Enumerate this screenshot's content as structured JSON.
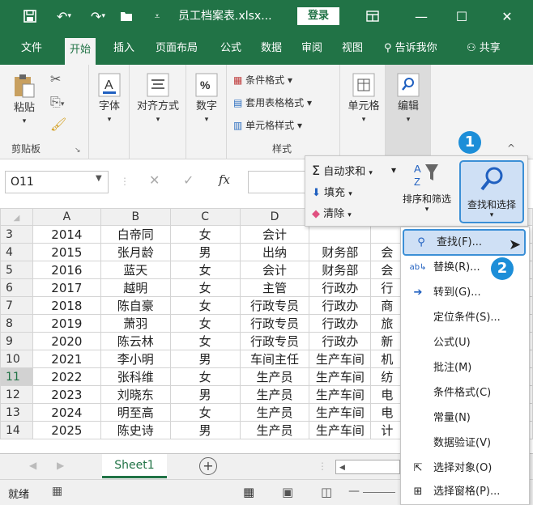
{
  "titlebar": {
    "title": "员工档案表.xlsx...",
    "login": "登录"
  },
  "menu_tabs": [
    "文件",
    "开始",
    "插入",
    "页面布局",
    "公式",
    "数据",
    "审阅",
    "视图"
  ],
  "tell_me": "告诉我你",
  "share": "共享",
  "ribbon": {
    "paste": "粘贴",
    "clipboard": "剪贴板",
    "font": "字体",
    "align": "对齐方式",
    "number": "数字",
    "cond_format": "条件格式",
    "table_format": "套用表格格式",
    "cell_style": "单元格样式",
    "styles": "样式",
    "cells": "单元格",
    "edit": "编辑"
  },
  "namebox": "O11",
  "fx": "fx",
  "columns": [
    "A",
    "B",
    "C",
    "D"
  ],
  "rows": [
    {
      "n": "3",
      "a": "2014",
      "b": "白帝同",
      "c": "女",
      "d": "会计",
      "e": "",
      "f": ""
    },
    {
      "n": "4",
      "a": "2015",
      "b": "张月龄",
      "c": "男",
      "d": "出纳",
      "e": "财务部",
      "f": "会"
    },
    {
      "n": "5",
      "a": "2016",
      "b": "蓝天",
      "c": "女",
      "d": "会计",
      "e": "财务部",
      "f": "会"
    },
    {
      "n": "6",
      "a": "2017",
      "b": "越明",
      "c": "女",
      "d": "主管",
      "e": "行政办",
      "f": "行"
    },
    {
      "n": "7",
      "a": "2018",
      "b": "陈自豪",
      "c": "女",
      "d": "行政专员",
      "e": "行政办",
      "f": "商"
    },
    {
      "n": "8",
      "a": "2019",
      "b": "萧羽",
      "c": "女",
      "d": "行政专员",
      "e": "行政办",
      "f": "旅"
    },
    {
      "n": "9",
      "a": "2020",
      "b": "陈云林",
      "c": "女",
      "d": "行政专员",
      "e": "行政办",
      "f": "新"
    },
    {
      "n": "10",
      "a": "2021",
      "b": "李小明",
      "c": "男",
      "d": "车间主任",
      "e": "生产车间",
      "f": "机"
    },
    {
      "n": "11",
      "a": "2022",
      "b": "张科维",
      "c": "女",
      "d": "生产员",
      "e": "生产车间",
      "f": "纺"
    },
    {
      "n": "12",
      "a": "2023",
      "b": "刘晓东",
      "c": "男",
      "d": "生产员",
      "e": "生产车间",
      "f": "电"
    },
    {
      "n": "13",
      "a": "2024",
      "b": "明至高",
      "c": "女",
      "d": "生产员",
      "e": "生产车间",
      "f": "电"
    },
    {
      "n": "14",
      "a": "2025",
      "b": "陈史诗",
      "c": "男",
      "d": "生产员",
      "e": "生产车间",
      "f": "计"
    }
  ],
  "sheet_tab": "Sheet1",
  "status": "就绪",
  "panel": {
    "autosum": "自动求和",
    "fill": "填充",
    "clear": "清除",
    "sort": "排序和筛选",
    "find": "查找和选择"
  },
  "menu_items": [
    "查找(F)...",
    "替换(R)...",
    "转到(G)...",
    "定位条件(S)...",
    "公式(U)",
    "批注(M)",
    "条件格式(C)",
    "常量(N)",
    "数据验证(V)",
    "选择对象(O)",
    "选择窗格(P)..."
  ],
  "badges": [
    "1",
    "2"
  ],
  "colors": {
    "excel_green": "#217346",
    "accent_blue": "#1d8ed8",
    "highlight": "#cfe0f5"
  }
}
